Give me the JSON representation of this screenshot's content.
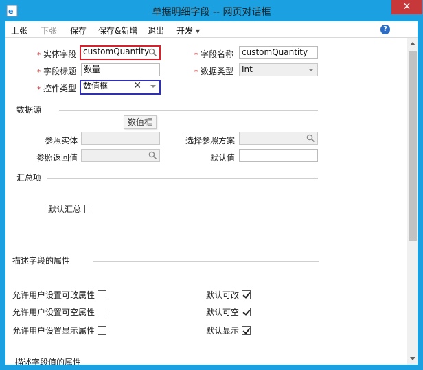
{
  "window": {
    "title": "单据明细字段 -- 网页对话框",
    "close_glyph": "✕"
  },
  "toolbar": {
    "items": [
      "上张",
      "下张",
      "保存",
      "保存&新增",
      "退出",
      "开发"
    ],
    "help_glyph": "?"
  },
  "form": {
    "entity_field_label": "实体字段",
    "entity_field_value": "customQuantity",
    "field_name_label": "字段名称",
    "field_name_value": "customQuantity",
    "field_title_label": "字段标题",
    "field_title_value": "数量",
    "data_type_label": "数据类型",
    "data_type_value": "Int",
    "control_type_label": "控件类型",
    "control_type_value": "数值框",
    "clear_glyph": "✕",
    "tooltip": "数值框",
    "required_mark": "*"
  },
  "datasource": {
    "title": "数据源",
    "ref_entity_label": "参照实体",
    "ref_scheme_label": "选择参照方案",
    "ref_return_label": "参照返回值",
    "default_label": "默认值"
  },
  "summary": {
    "title": "汇总项",
    "default_sum_label": "默认汇总",
    "default_sum_checked": false
  },
  "attributes": {
    "title": "描述字段的属性",
    "allow_editable_label": "允许用户设置可改属性",
    "allow_nullable_label": "允许用户设置可空属性",
    "allow_display_label": "允许用户设置显示属性",
    "default_editable_label": "默认可改",
    "default_nullable_label": "默认可空",
    "default_display_label": "默认显示",
    "allow_editable_checked": false,
    "allow_nullable_checked": false,
    "allow_display_checked": false,
    "default_editable_checked": true,
    "default_nullable_checked": true,
    "default_display_checked": true
  },
  "value_attributes": {
    "title": "描述字段值的属性"
  },
  "colors": {
    "titlebar": "#1ba1e2",
    "close": "#c7383b",
    "required": "#d03030",
    "highlight_red": "#d9212e",
    "highlight_blue": "#2f2fb3"
  }
}
